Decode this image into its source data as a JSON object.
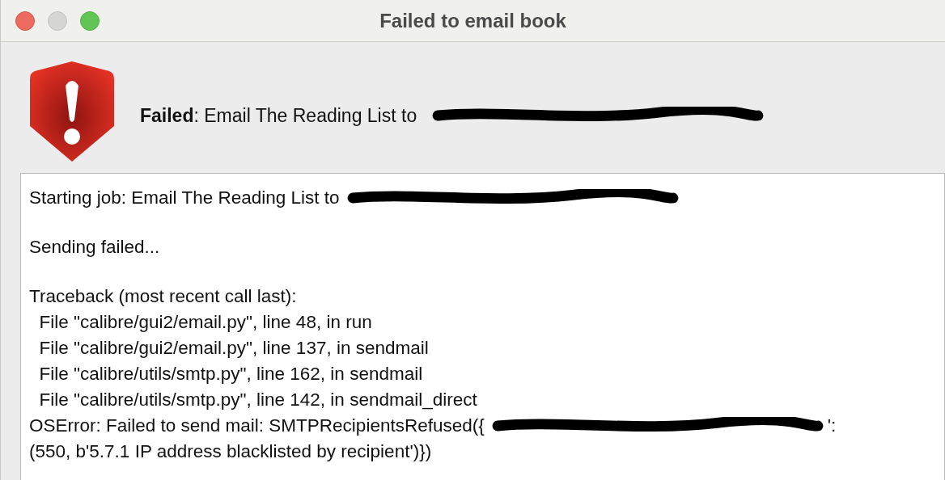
{
  "window": {
    "title": "Failed to email book"
  },
  "header": {
    "bold": "Failed",
    "message": ": Email The Reading List to",
    "redacted": true
  },
  "log": [
    [
      {
        "text": "Starting job: Email The Reading List to",
        "redacted": true
      }
    ],
    [
      {
        "text": "Sending failed...",
        "redacted": false
      }
    ],
    [
      {
        "text": "Traceback (most recent call last):",
        "redacted": false
      },
      {
        "text": "  File \"calibre/gui2/email.py\", line 48, in run",
        "redacted": false
      },
      {
        "text": "  File \"calibre/gui2/email.py\", line 137, in sendmail",
        "redacted": false
      },
      {
        "text": "  File \"calibre/utils/smtp.py\", line 162, in sendmail",
        "redacted": false
      },
      {
        "text": "  File \"calibre/utils/smtp.py\", line 142, in sendmail_direct",
        "redacted": false
      },
      {
        "text": "OSError: Failed to send mail: SMTPRecipientsRefused({",
        "redacted": true,
        "after": "':"
      },
      {
        "text": "(550, b'5.7.1 IP address blacklisted by recipient')})",
        "redacted": false
      }
    ]
  ]
}
